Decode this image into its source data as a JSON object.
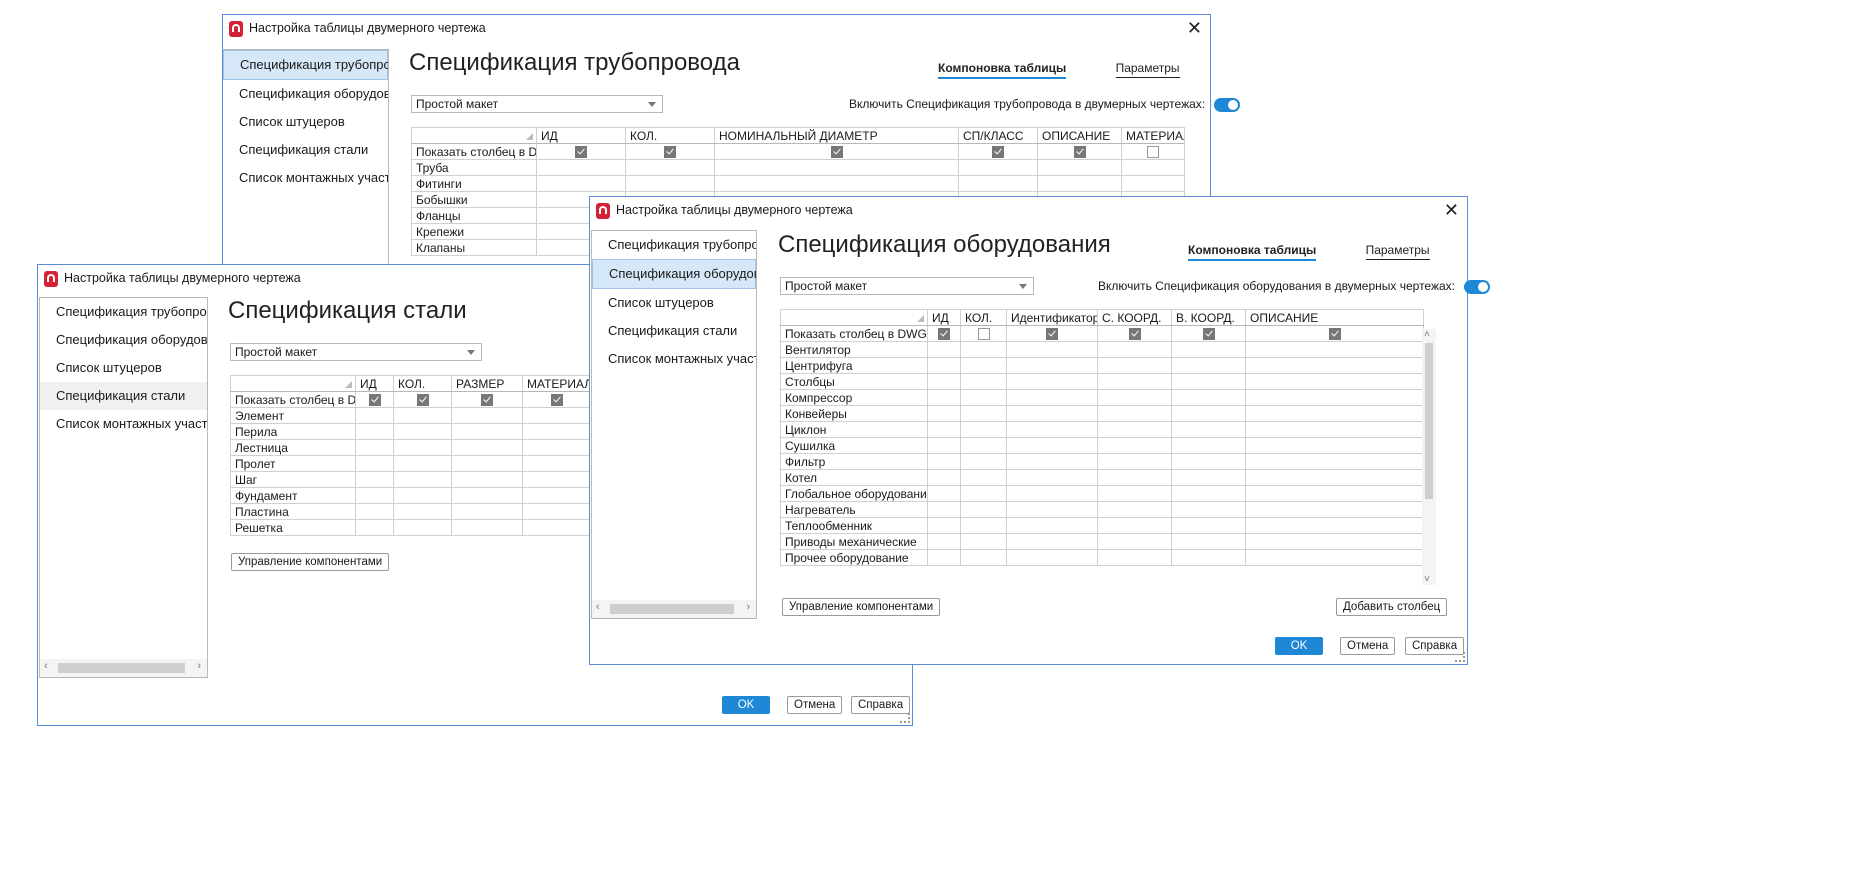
{
  "window_title": "Настройка таблицы двумерного чертежа",
  "nav_items": [
    "Спецификация трубопровода",
    "Спецификация оборудования",
    "Список штуцеров",
    "Спецификация стали",
    "Список монтажных участков"
  ],
  "tabs": {
    "layout": "Компоновка таблицы",
    "params": "Параметры"
  },
  "layout_select": "Простой макет",
  "buttons": {
    "ok": "OK",
    "cancel": "Отмена",
    "help": "Справка",
    "manage": "Управление компонентами",
    "add_column": "Добавить столбец"
  },
  "colors": {
    "accent": "#1e88d6",
    "selected_bg": "#d6e8f8",
    "window_border": "#5b8bd6",
    "app_icon": "#d32236"
  },
  "pipe_window": {
    "heading": "Спецификация трубопровода",
    "enable_label": "Включить  Спецификация трубопровода  в двумерных чертежах:",
    "columns": [
      "ИД",
      "КОЛ.",
      "НОМИНАЛЬНЫЙ ДИАМЕТР",
      "СП/КЛАСС",
      "ОПИСАНИЕ",
      "МАТЕРИАЛ"
    ],
    "show_row_label": "Показать столбец в DWG",
    "show_checks": [
      true,
      true,
      true,
      true,
      true,
      false
    ],
    "rows": [
      "Труба",
      "Фитинги",
      "Бобышки",
      "Фланцы",
      "Крепежи",
      "Клапаны"
    ]
  },
  "steel_window": {
    "heading": "Спецификация стали",
    "columns": [
      "ИД",
      "КОЛ.",
      "РАЗМЕР",
      "МАТЕРИАЛ"
    ],
    "show_row_label": "Показать столбец в DWG",
    "show_checks": [
      true,
      true,
      true,
      true
    ],
    "rows": [
      "Элемент",
      "Перила",
      "Лестница",
      "Пролет",
      "Шаг",
      "Фундамент",
      "Пластина",
      "Решетка"
    ]
  },
  "equip_window": {
    "heading": "Спецификация оборудования",
    "enable_label": "Включить  Спецификация оборудования  в двумерных чертежах:",
    "columns": [
      "ИД",
      "КОЛ.",
      "Идентификатор",
      "С. КООРД.",
      "В. КООРД.",
      "ОПИСАНИЕ"
    ],
    "show_row_label": "Показать столбец в DWG",
    "show_checks": [
      true,
      false,
      true,
      true,
      true,
      true
    ],
    "rows": [
      "Вентилятор",
      "Центрифуга",
      "Столбцы",
      "Компрессор",
      "Конвейеры",
      "Циклон",
      "Сушилка",
      "Фильтр",
      "Котел",
      "Глобальное оборудование",
      "Нагреватель",
      "Теплообменник",
      "Приводы механические",
      "Прочее оборудование"
    ]
  }
}
